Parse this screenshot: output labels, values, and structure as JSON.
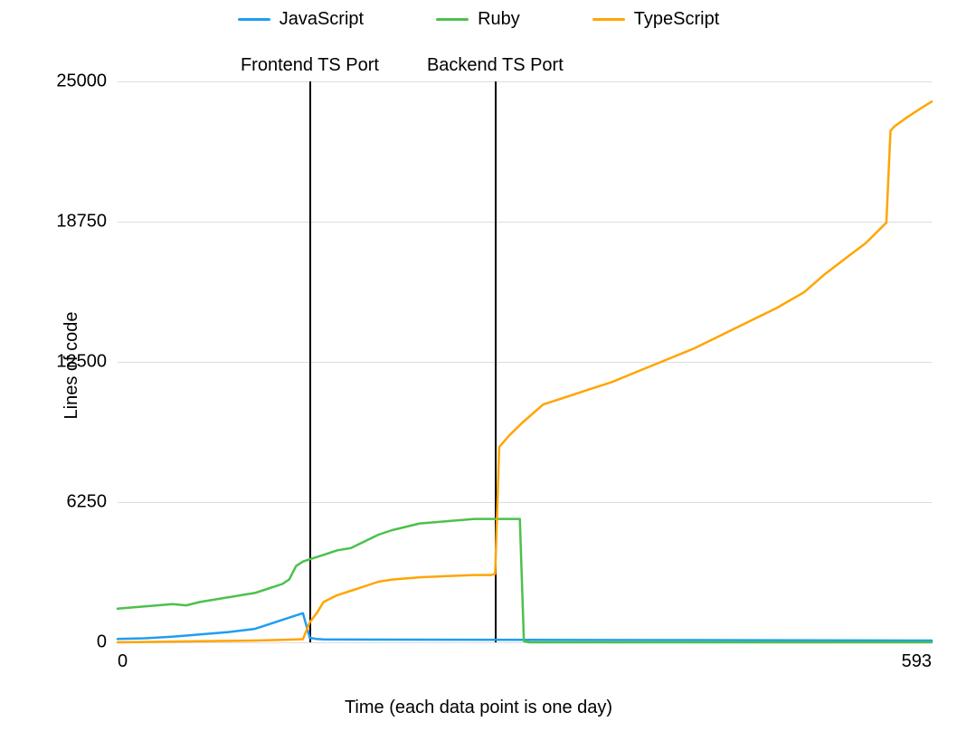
{
  "legend": {
    "items": [
      {
        "label": "JavaScript",
        "color": "#1f9df1"
      },
      {
        "label": "Ruby",
        "color": "#4cc14c"
      },
      {
        "label": "TypeScript",
        "color": "#ffa500"
      }
    ]
  },
  "axes": {
    "ylabel": "Lines of code",
    "xlabel": "Time (each data point is one day)",
    "yticks": [
      "0",
      "6250",
      "12500",
      "18750",
      "25000"
    ],
    "xticks": [
      "0",
      "593"
    ],
    "xlim": [
      0,
      593
    ],
    "ylim": [
      0,
      25000
    ]
  },
  "annotations": [
    {
      "label": "Frontend TS Port",
      "x": 140
    },
    {
      "label": "Backend TS Port",
      "x": 275
    }
  ],
  "chart_data": {
    "type": "line",
    "title": "",
    "xlabel": "Time (each data point is one day)",
    "ylabel": "Lines of code",
    "xlim": [
      0,
      593
    ],
    "ylim": [
      0,
      25000
    ],
    "annotations": [
      {
        "label": "Frontend TS Port",
        "x": 140
      },
      {
        "label": "Backend TS Port",
        "x": 275
      }
    ],
    "series": [
      {
        "name": "JavaScript",
        "color": "#1f9df1",
        "x": [
          0,
          20,
          40,
          60,
          80,
          100,
          110,
          120,
          130,
          135,
          140,
          145,
          150,
          200,
          300,
          400,
          500,
          593
        ],
        "values": [
          150,
          180,
          250,
          350,
          450,
          600,
          800,
          1000,
          1200,
          1300,
          200,
          150,
          130,
          120,
          110,
          100,
          90,
          80
        ]
      },
      {
        "name": "Ruby",
        "color": "#4cc14c",
        "x": [
          0,
          20,
          40,
          50,
          60,
          70,
          80,
          90,
          100,
          110,
          120,
          125,
          130,
          135,
          140,
          150,
          160,
          170,
          180,
          190,
          200,
          220,
          240,
          260,
          275,
          290,
          293,
          296,
          300,
          400,
          500,
          593
        ],
        "values": [
          1500,
          1600,
          1700,
          1650,
          1800,
          1900,
          2000,
          2100,
          2200,
          2400,
          2600,
          2800,
          3400,
          3600,
          3700,
          3900,
          4100,
          4200,
          4500,
          4800,
          5000,
          5300,
          5400,
          5500,
          5500,
          5500,
          5500,
          50,
          0,
          0,
          0,
          0
        ]
      },
      {
        "name": "TypeScript",
        "color": "#ffa500",
        "x": [
          0,
          60,
          100,
          120,
          135,
          140,
          145,
          150,
          160,
          170,
          180,
          190,
          200,
          220,
          240,
          260,
          272,
          275,
          278,
          285,
          295,
          310,
          325,
          340,
          360,
          380,
          400,
          420,
          440,
          460,
          480,
          500,
          515,
          530,
          545,
          555,
          560,
          563,
          566,
          575,
          585,
          593
        ],
        "values": [
          0,
          50,
          80,
          110,
          140,
          900,
          1300,
          1800,
          2100,
          2300,
          2500,
          2700,
          2800,
          2900,
          2950,
          3000,
          3000,
          3050,
          8700,
          9200,
          9800,
          10600,
          10900,
          11200,
          11600,
          12100,
          12600,
          13100,
          13700,
          14300,
          14900,
          15600,
          16400,
          17100,
          17800,
          18400,
          18700,
          22800,
          23000,
          23400,
          23800,
          24100
        ]
      }
    ]
  }
}
